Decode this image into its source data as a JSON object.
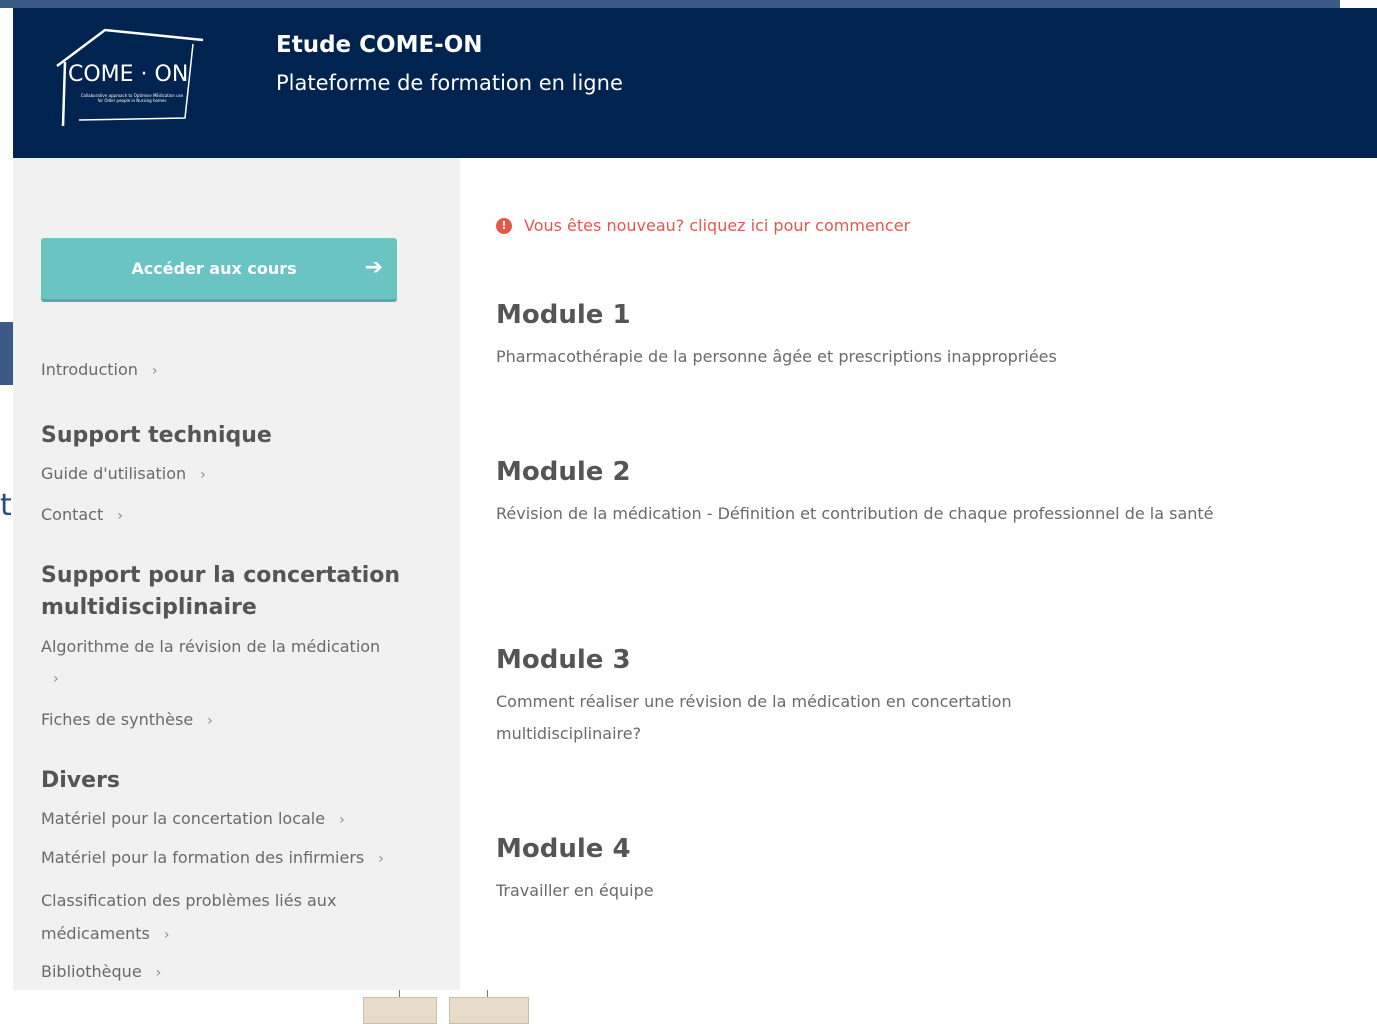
{
  "header": {
    "logo_name": "COME · ON",
    "logo_tagline": "Collaborative approach to Optimise MEdication use for Older people in Nursing homes",
    "title": "Etude COME-ON",
    "subtitle": "Plateforme de formation en ligne"
  },
  "sidebar": {
    "courses_button": "Accéder aux cours",
    "intro": "Introduction",
    "sections": [
      {
        "title": "Support technique",
        "links": [
          "Guide d'utilisation",
          "Contact"
        ]
      },
      {
        "title": "Support pour la concertation multidisciplinaire",
        "links": [
          "Algorithme de la révision de la médication",
          "Fiches de synthèse"
        ]
      },
      {
        "title": "Divers",
        "links": [
          "Matériel pour la concertation locale",
          "Matériel pour la formation des infirmiers",
          "Classification des problèmes liés aux médicaments",
          "Bibliothèque"
        ]
      }
    ]
  },
  "main": {
    "notice": "Vous êtes nouveau? cliquez ici pour commencer",
    "modules": [
      {
        "title": "Module 1",
        "desc": "Pharmacothérapie de la personne âgée et prescriptions inappropriées"
      },
      {
        "title": "Module 2",
        "desc": "Révision de la médication - Définition et contribution de chaque professionnel de la santé"
      },
      {
        "title": "Module 3",
        "desc": "Comment réaliser une révision de la médication en concertation multidisciplinaire?"
      },
      {
        "title": "Module 4",
        "desc": "Travailler en équipe"
      }
    ]
  },
  "background": {
    "glyph": "t"
  },
  "colors": {
    "header_bg": "#00234f",
    "button": "#6ac4c1",
    "notice": "#e4584b",
    "sidebar_bg": "#f1f1f1"
  }
}
